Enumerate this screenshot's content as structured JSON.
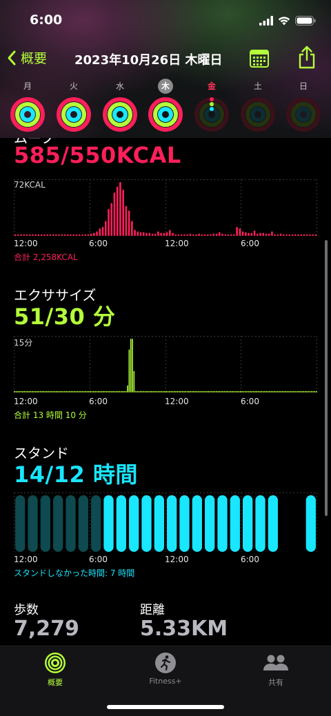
{
  "status": {
    "time": "6:00"
  },
  "nav": {
    "back_label": "概要",
    "title": "2023年10月26日 木曜日"
  },
  "week": [
    {
      "label": "月",
      "state": "closed"
    },
    {
      "label": "火",
      "state": "closed"
    },
    {
      "label": "水",
      "state": "closed"
    },
    {
      "label": "木",
      "state": "closed",
      "selected": true
    },
    {
      "label": "金",
      "state": "current"
    },
    {
      "label": "土",
      "state": "empty"
    },
    {
      "label": "日",
      "state": "empty"
    }
  ],
  "move": {
    "label": "ムーブ",
    "value": "585/550KCAL",
    "chart_max_label": "72KCAL",
    "total": "合計 2,258KCAL",
    "color": "#ff1f5a"
  },
  "exercise": {
    "label": "エクササイズ",
    "value": "51/30 分",
    "chart_max_label": "15分",
    "total": "合計 13 時間 10 分",
    "color": "#b4ff3a"
  },
  "stand": {
    "label": "スタンド",
    "value": "14/12 時間",
    "total": "スタンドしなかった時間: 7 時間",
    "color": "#19e6ff"
  },
  "x_ticks": [
    "12:00",
    "6:00",
    "12:00",
    "6:00"
  ],
  "steps": {
    "label": "歩数",
    "value": "7,279"
  },
  "distance": {
    "label": "距離",
    "value": "5.33KM"
  },
  "tabs": [
    {
      "label": "概要",
      "active": true
    },
    {
      "label": "Fitness+",
      "active": false
    },
    {
      "label": "共有",
      "active": false
    }
  ],
  "chart_data": [
    {
      "type": "bar",
      "title": "ムーブ",
      "ylabel": "KCAL",
      "ylim": [
        0,
        72
      ],
      "values": [
        2,
        1,
        2,
        1,
        2,
        1,
        2,
        1,
        2,
        1,
        2,
        1,
        2,
        1,
        2,
        1,
        2,
        1,
        2,
        1,
        2,
        1,
        2,
        1,
        2,
        2,
        3,
        4,
        6,
        10,
        12,
        20,
        36,
        44,
        58,
        66,
        72,
        62,
        40,
        34,
        20,
        8,
        6,
        5,
        5,
        4,
        4,
        3,
        3,
        6,
        4,
        4,
        5,
        8,
        4,
        2,
        2,
        2,
        2,
        2,
        3,
        2,
        2,
        3,
        2,
        2,
        2,
        2,
        3,
        3,
        5,
        3,
        2,
        2,
        2,
        2,
        12,
        10,
        6,
        5,
        4,
        4,
        7,
        3,
        4,
        4,
        3,
        3,
        6,
        2,
        2,
        3,
        2,
        2,
        2,
        2,
        2,
        2,
        2,
        2,
        2,
        2,
        2,
        2
      ]
    },
    {
      "type": "bar",
      "title": "エクササイズ",
      "ylabel": "分",
      "ylim": [
        0,
        15
      ],
      "values": [
        0,
        0,
        0,
        0,
        0,
        0,
        0,
        0,
        0,
        0,
        0,
        0,
        0,
        0,
        0,
        0,
        0,
        0,
        0,
        0,
        0,
        0,
        0,
        0,
        0,
        0,
        0,
        0,
        0,
        0,
        0,
        0,
        0,
        0,
        0,
        0,
        0,
        0,
        0,
        0,
        0,
        0,
        0,
        0,
        0,
        0,
        0,
        0,
        0,
        0,
        0,
        0,
        0,
        0,
        0,
        0,
        0,
        0,
        0,
        0,
        0,
        0,
        0,
        0,
        0,
        0,
        0,
        0,
        0,
        0,
        2,
        12,
        15,
        15,
        6,
        0,
        0,
        0,
        0,
        0,
        0,
        0,
        0,
        0,
        0,
        0,
        0,
        0,
        0,
        0,
        0,
        0,
        0,
        0,
        0,
        0,
        0,
        0,
        0,
        0,
        0,
        0,
        0,
        0,
        0,
        0,
        0,
        0,
        0,
        0,
        0,
        0,
        0,
        0,
        0,
        0,
        0,
        0,
        0,
        0,
        0,
        0,
        0,
        0,
        0,
        0,
        0,
        0,
        0,
        0,
        0,
        0,
        0,
        0,
        0,
        0,
        0,
        0,
        0,
        0,
        0,
        0,
        0,
        0,
        0,
        0,
        0,
        0,
        0,
        0,
        0,
        0,
        0,
        0,
        0,
        0,
        0,
        0,
        0,
        0,
        0,
        0,
        0,
        0,
        0,
        0,
        0,
        0,
        0,
        0,
        0,
        0,
        0,
        0,
        0,
        0,
        0,
        0,
        0,
        0,
        0,
        0,
        0,
        0,
        0,
        0,
        0,
        0
      ]
    },
    {
      "type": "bar",
      "title": "スタンド",
      "categories": [
        "0",
        "1",
        "2",
        "3",
        "4",
        "5",
        "6",
        "7",
        "8",
        "9",
        "10",
        "11",
        "12",
        "13",
        "14",
        "15",
        "16",
        "17",
        "18",
        "19",
        "20",
        "21",
        "22",
        "23"
      ],
      "values": [
        1,
        1,
        1,
        1,
        1,
        1,
        1,
        2,
        2,
        2,
        2,
        2,
        2,
        2,
        2,
        2,
        2,
        2,
        2,
        2,
        2,
        0,
        0,
        2
      ]
    }
  ]
}
